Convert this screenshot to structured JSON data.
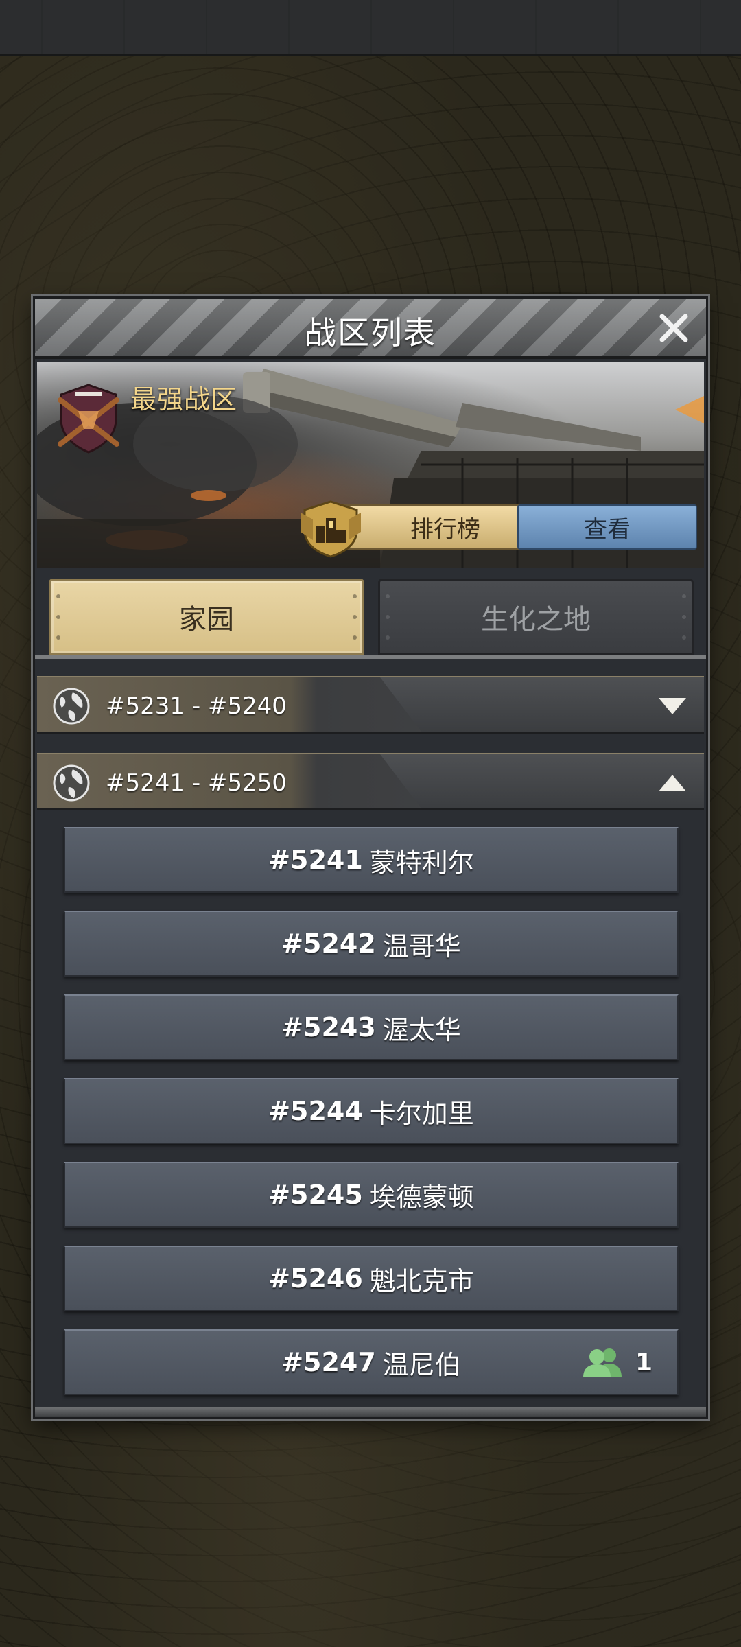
{
  "panel": {
    "title": "战区列表"
  },
  "banner": {
    "title": "最强战区",
    "ranking_label": "排行榜",
    "view_label": "查看"
  },
  "tabs": [
    {
      "label": "家园",
      "active": true
    },
    {
      "label": "生化之地",
      "active": false
    }
  ],
  "groups": [
    {
      "range": "#5231 - #5240",
      "expanded": false
    },
    {
      "range": "#5241 - #5250",
      "expanded": true
    }
  ],
  "servers": [
    {
      "id": "#5241",
      "name": "蒙特利尔"
    },
    {
      "id": "#5242",
      "name": "温哥华"
    },
    {
      "id": "#5243",
      "name": "渥太华"
    },
    {
      "id": "#5244",
      "name": "卡尔加里"
    },
    {
      "id": "#5245",
      "name": "埃德蒙顿"
    },
    {
      "id": "#5246",
      "name": "魁北克市"
    },
    {
      "id": "#5247",
      "name": "温尼伯",
      "players": "1"
    }
  ],
  "icons": {
    "close": "close-icon",
    "emblem": "crossed-rifles-emblem-icon",
    "ranking": "podium-shield-icon",
    "globe": "globe-icon",
    "collapsed": "chevron-down-icon",
    "expanded": "chevron-up-icon",
    "players": "players-icon"
  },
  "colors": {
    "gold_text": "#f4d68b",
    "view_button": "#6e93bf",
    "home_tab": "#e0cb98",
    "players_icon": "#7cc47a"
  }
}
